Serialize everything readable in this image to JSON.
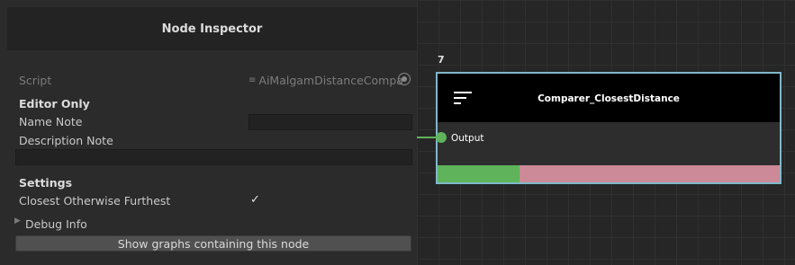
{
  "inspector": {
    "title": "Node Inspector",
    "script_label": "Script",
    "script_value": "AiMalgamDistanceCompa",
    "editor_only_header": "Editor Only",
    "name_note_label": "Name Note",
    "name_note_value": "",
    "description_note_label": "Description Note",
    "description_note_value": "",
    "settings_header": "Settings",
    "closest_label": "Closest Otherwise Furthest",
    "closest_checked": true,
    "debug_info_label": "Debug Info",
    "graphs_button_label": "Show graphs containing this node"
  },
  "node": {
    "index": "7",
    "title": "Comparer_ClosestDistance",
    "output_port_label": "Output",
    "progress_fraction": 0.24
  },
  "colors": {
    "port": "#5fb35a",
    "selection_border": "#7fb8c9",
    "bar_remaining": "#cc8a98"
  }
}
